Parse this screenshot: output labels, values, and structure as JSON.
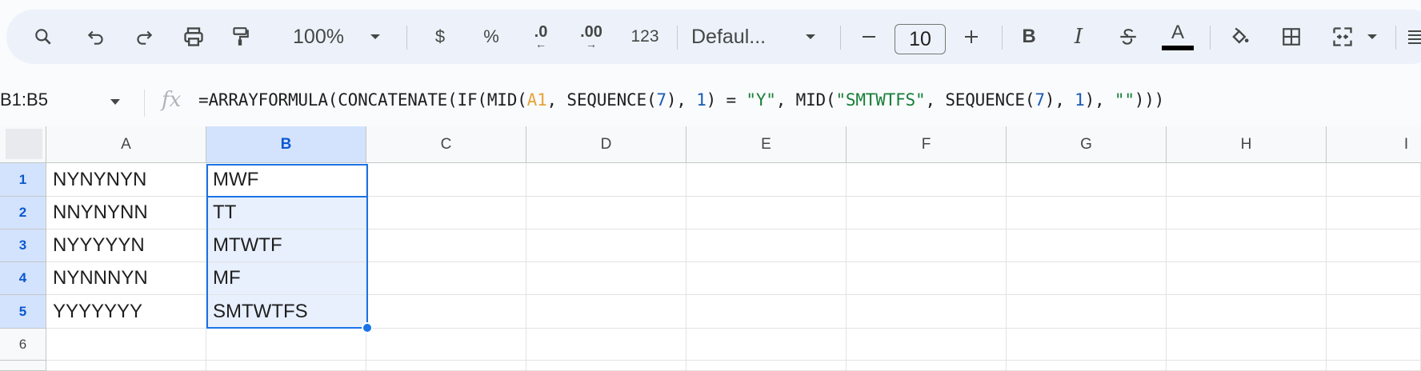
{
  "toolbar": {
    "zoom": "100%",
    "currency_label": "$",
    "percent_label": "%",
    "dec_decrease_label": ".0",
    "dec_increase_label": ".00",
    "number_format_label": "123",
    "font_family": "Defaul...",
    "font_size": "10",
    "bold_label": "B",
    "italic_label": "I",
    "text_color_label": "A",
    "text_color": "#000000"
  },
  "formula_bar": {
    "name_box": "B1:B5",
    "fx_label": "fx",
    "formula": {
      "p1": "=ARRAYFORMULA(CONCATENATE(IF(MID(",
      "ref": "A1",
      "p2": ", SEQUENCE(",
      "n1": "7",
      "p3": "), ",
      "n2": "1",
      "p4": ") = ",
      "s1": "\"Y\"",
      "p5": ", MID(",
      "s2": "\"SMTWTFS\"",
      "p6": ", SEQUENCE(",
      "n3": "7",
      "p7": "), ",
      "n4": "1",
      "p8": "), ",
      "s3": "\"\"",
      "p9": ")))"
    }
  },
  "grid": {
    "columns": [
      "A",
      "B",
      "C",
      "D",
      "E",
      "F",
      "G",
      "H",
      "I"
    ],
    "rows": [
      "1",
      "2",
      "3",
      "4",
      "5",
      "6"
    ],
    "colA": [
      "NYNYNYN",
      "NNYNYNN",
      "NYYYYYN",
      "NYNNNYN",
      "YYYYYYY",
      ""
    ],
    "colB": [
      "MWF",
      "TT",
      "MTWTF",
      "MF",
      "SMTWTFS",
      ""
    ]
  },
  "colors": {
    "selection_border": "#1a73e8",
    "selection_fill": "#e8f0fe",
    "header_selected": "#d3e3fd"
  }
}
